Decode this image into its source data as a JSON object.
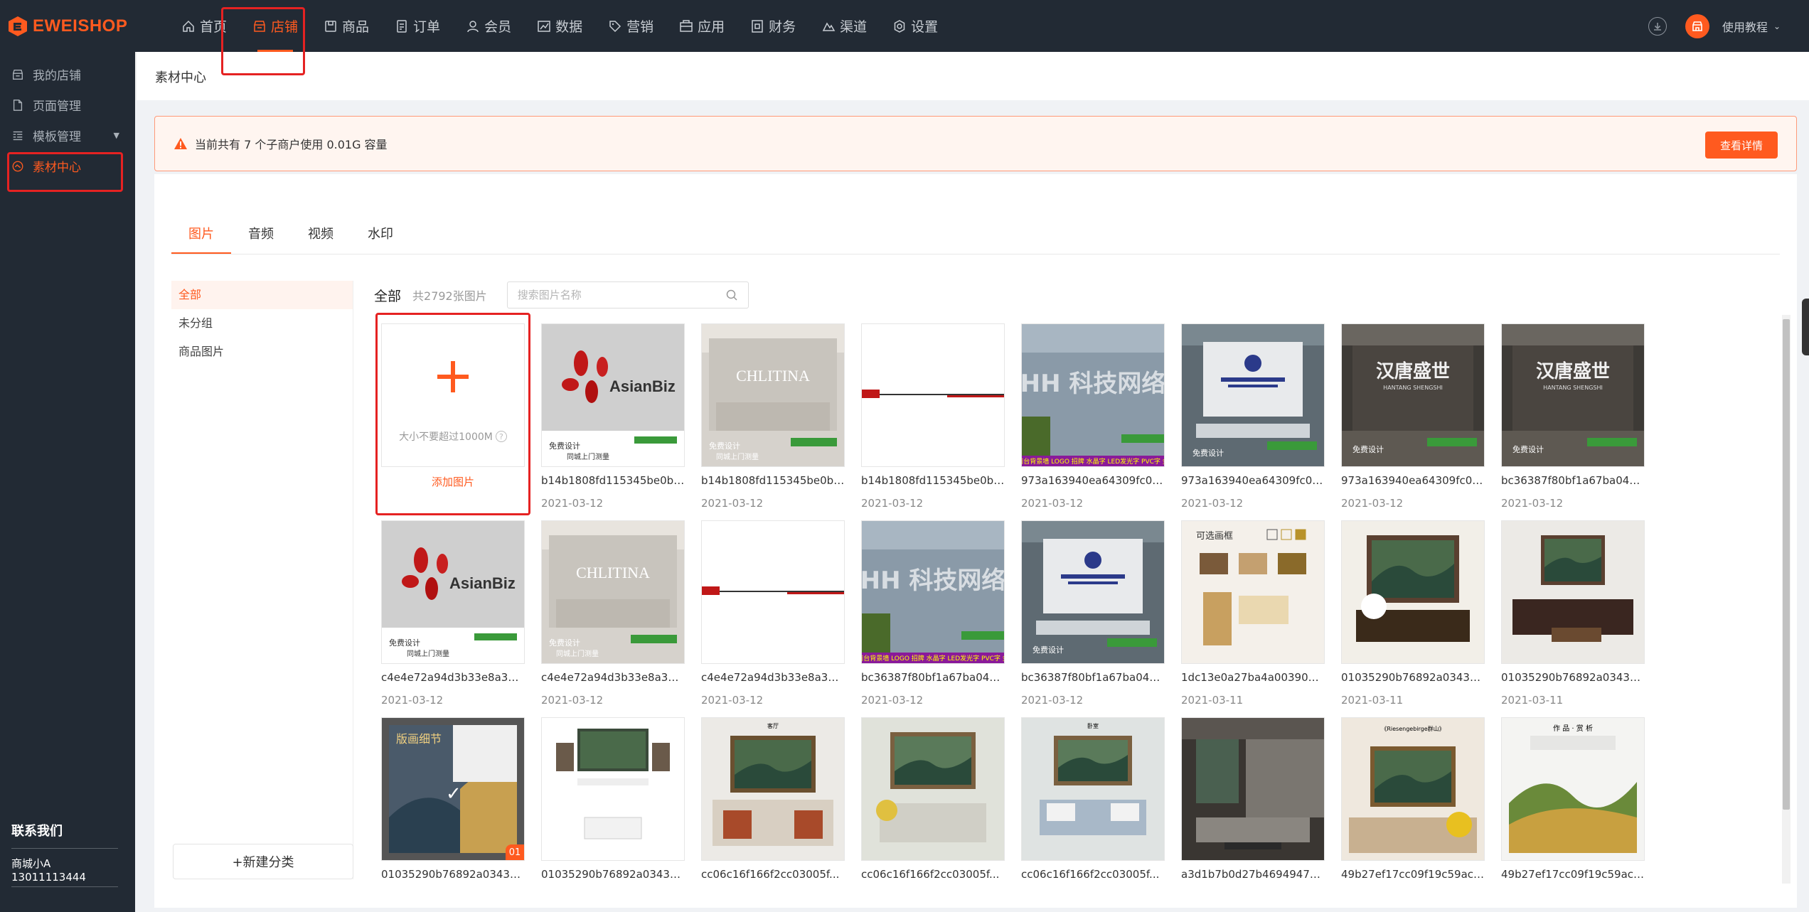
{
  "brand": {
    "name": "EWEISHOP",
    "accent": "#ff5a1f"
  },
  "nav": [
    {
      "label": "首页",
      "icon": "home-icon"
    },
    {
      "label": "店铺",
      "icon": "store-icon",
      "active": true
    },
    {
      "label": "商品",
      "icon": "goods-icon"
    },
    {
      "label": "订单",
      "icon": "order-icon"
    },
    {
      "label": "会员",
      "icon": "member-icon"
    },
    {
      "label": "数据",
      "icon": "chart-icon"
    },
    {
      "label": "营销",
      "icon": "tag-icon"
    },
    {
      "label": "应用",
      "icon": "app-icon"
    },
    {
      "label": "财务",
      "icon": "finance-icon"
    },
    {
      "label": "渠道",
      "icon": "channel-icon"
    },
    {
      "label": "设置",
      "icon": "gear-icon"
    }
  ],
  "top_right": {
    "help_label": "使用教程"
  },
  "sidebar": {
    "items": [
      {
        "label": "我的店铺",
        "icon": "store-icon"
      },
      {
        "label": "页面管理",
        "icon": "page-icon"
      },
      {
        "label": "模板管理",
        "icon": "template-icon",
        "has_caret": true
      },
      {
        "label": "素材中心",
        "icon": "material-icon",
        "active": true
      }
    ],
    "contact": {
      "title": "联系我们",
      "name": "商城小A",
      "phone": "13011113444"
    }
  },
  "breadcrumb": "素材中心",
  "alert": {
    "text": "当前共有 7 个子商户使用 0.01G 容量",
    "button": "查看详情"
  },
  "tabs": [
    "图片",
    "音频",
    "视频",
    "水印"
  ],
  "groups": {
    "items": [
      "全部",
      "未分组",
      "商品图片"
    ],
    "new_label": "+新建分类"
  },
  "filter": {
    "current": "全部",
    "count": "共2792张图片",
    "search_placeholder": "搜索图片名称"
  },
  "upload": {
    "hint": "大小不要超过1000M",
    "label": "添加图片"
  },
  "images": [
    {
      "name": "b14b1808fd115345be0b6...",
      "date": "2021-03-12",
      "kind": "asianbiz"
    },
    {
      "name": "b14b1808fd115345be0b6...",
      "date": "2021-03-12",
      "kind": "chlitina"
    },
    {
      "name": "b14b1808fd115345be0b6...",
      "date": "2021-03-12",
      "kind": "banner"
    },
    {
      "name": "973a163940ea64309fc00...",
      "date": "2021-03-12",
      "kind": "tech"
    },
    {
      "name": "973a163940ea64309fc00...",
      "date": "2021-03-12",
      "kind": "office"
    },
    {
      "name": "973a163940ea64309fc00...",
      "date": "2021-03-12",
      "kind": "hantang"
    },
    {
      "name": "bc36387f80bf1a67ba04c...",
      "date": "2021-03-12",
      "kind": "hantang"
    },
    {
      "name": "c4e4e72a94d3b33e8a3a3...",
      "date": "2021-03-12",
      "kind": "asianbiz"
    },
    {
      "name": "c4e4e72a94d3b33e8a3a3...",
      "date": "2021-03-12",
      "kind": "chlitina"
    },
    {
      "name": "c4e4e72a94d3b33e8a3a3...",
      "date": "2021-03-12",
      "kind": "banner"
    },
    {
      "name": "bc36387f80bf1a67ba04c...",
      "date": "2021-03-12",
      "kind": "tech"
    },
    {
      "name": "bc36387f80bf1a67ba04c...",
      "date": "2021-03-12",
      "kind": "office"
    },
    {
      "name": "1dc13e0a27ba4a0039003...",
      "date": "2021-03-11",
      "kind": "frames"
    },
    {
      "name": "01035290b76892a03436...",
      "date": "2021-03-11",
      "kind": "room1"
    },
    {
      "name": "01035290b76892a03436...",
      "date": "2021-03-11",
      "kind": "room2"
    },
    {
      "name": "01035290b76892a03436...",
      "date": "",
      "kind": "detail"
    },
    {
      "name": "01035290b76892a03436...",
      "date": "",
      "kind": "doc"
    },
    {
      "name": "cc06c16f166f2cc03005f...",
      "date": "",
      "kind": "bedroom"
    },
    {
      "name": "cc06c16f166f2cc03005f...",
      "date": "",
      "kind": "sofa"
    },
    {
      "name": "cc06c16f166f2cc03005f...",
      "date": "",
      "kind": "bed2"
    },
    {
      "name": "a3d1b7b0d27b46949473...",
      "date": "",
      "kind": "living"
    },
    {
      "name": "49b27ef17cc09f19c59ac0...",
      "date": "",
      "kind": "flowers"
    },
    {
      "name": "49b27ef17cc09f19c59ac0...",
      "date": "",
      "kind": "poster"
    }
  ]
}
